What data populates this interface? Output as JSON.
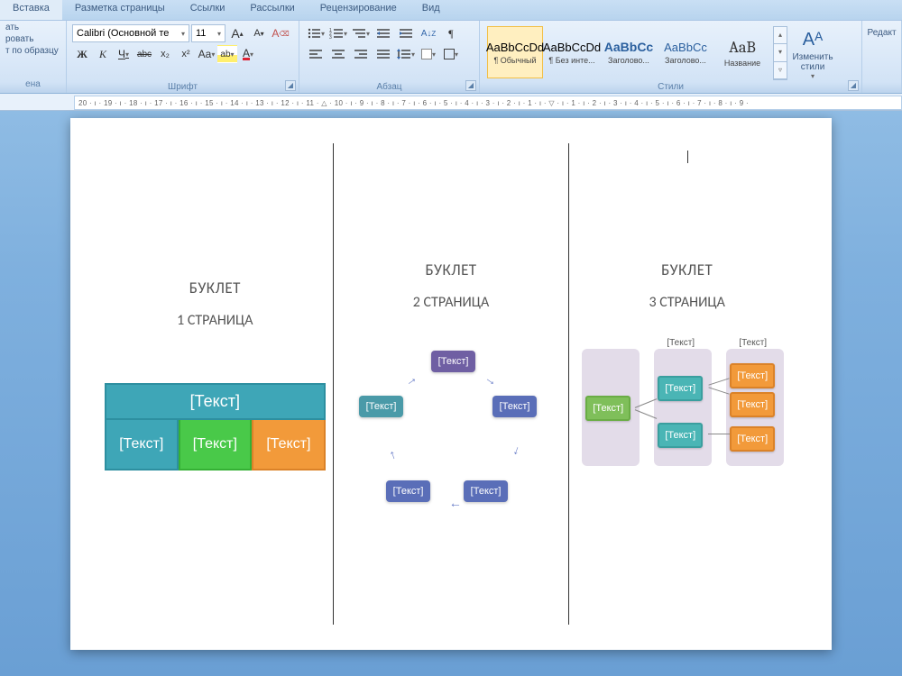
{
  "tabs": {
    "t1": "Вставка",
    "t2": "Разметка страницы",
    "t3": "Ссылки",
    "t4": "Рассылки",
    "t5": "Рецензирование",
    "t6": "Вид"
  },
  "clipboard": {
    "l1": "ать",
    "l2": "ровать",
    "l3": "т по образцу",
    "group_label": "ена"
  },
  "font": {
    "name": "Calibri (Основной те",
    "size": "11",
    "bold": "Ж",
    "italic": "К",
    "underline": "Ч",
    "strike": "abc",
    "sub": "x₂",
    "sup": "x²",
    "case": "Aa",
    "highlight": "ab",
    "color": "A",
    "grow": "A",
    "shrink": "A",
    "clear": "A",
    "group_label": "Шрифт"
  },
  "paragraph": {
    "group_label": "Абзац"
  },
  "styles": {
    "items": [
      {
        "preview": "AaBbCcDd",
        "name": "¶ Обычный"
      },
      {
        "preview": "AaBbCcDd",
        "name": "¶ Без инте..."
      },
      {
        "preview": "AaBbCc",
        "name": "Заголово..."
      },
      {
        "preview": "AaBbCc",
        "name": "Заголово..."
      },
      {
        "preview": "AaB",
        "name": "Название"
      }
    ],
    "change_label": "Изменить стили",
    "group_label": "Стили"
  },
  "editing": {
    "label": "Редакт"
  },
  "ruler_text": "20 · ı · 19 · ı · 18 · ı · 17 · ı · 16 · ı · 15 · ı · 14 · ı · 13 · ı · 12 · ı · 11 · △ · 10 · ı · 9 · ı · 8 · ı · 7 · ı · 6 · ı · 5 · ı · 4 · ı · 3 · ı · 2 · ı · 1 · ı · ▽ · ı · 1 · ı · 2 · ı · 3 · ı · 4 · ı · 5 · ı · 6 · ı · 7 · ı · 8 · ı · 9 ·",
  "doc": {
    "p1": {
      "title": "БУКЛЕТ",
      "sub": "1 СТРАНИЦА",
      "header": "[Текст]",
      "c1": "[Текст]",
      "c2": "[Текст]",
      "c3": "[Текст]"
    },
    "p2": {
      "title": "БУКЛЕТ",
      "sub": "2 СТРАНИЦА",
      "n1": "[Текст]",
      "n2": "[Текст]",
      "n3": "[Текст]",
      "n4": "[Текст]",
      "n5": "[Текст]"
    },
    "p3": {
      "title": "БУКЛЕТ",
      "sub": "3 СТРАНИЦА",
      "lbl1": "[Текст]",
      "lbl2": "[Текст]",
      "root": "[Текст]",
      "m1": "[Текст]",
      "m2": "[Текст]",
      "r1": "[Текст]",
      "r2": "[Текст]",
      "r3": "[Текст]"
    }
  }
}
